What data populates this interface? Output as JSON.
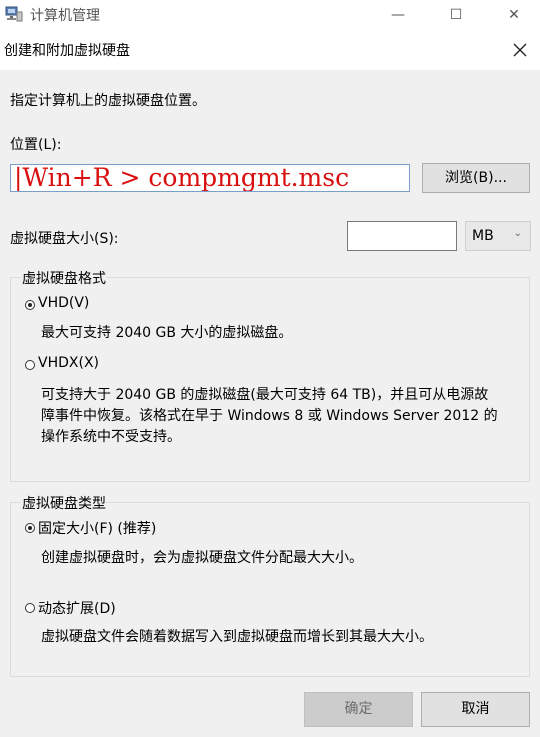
{
  "background_window": {
    "title": "计算机管理",
    "controls": {
      "minimize": "—",
      "maximize": "☐",
      "close": "✕"
    }
  },
  "dialog": {
    "title": "创建和附加虚拟硬盘",
    "instruction": "指定计算机上的虚拟硬盘位置。",
    "location": {
      "label": "位置(L):",
      "value": "|Win+R > compmgmt.msc",
      "browse_label": "浏览(B)..."
    },
    "size": {
      "label": "虚拟硬盘大小(S):",
      "value": "",
      "unit": "MB"
    },
    "format_group": {
      "legend": "虚拟硬盘格式",
      "options": [
        {
          "label": "VHD(V)",
          "checked": true,
          "description": "最大可支持 2040 GB 大小的虚拟磁盘。"
        },
        {
          "label": "VHDX(X)",
          "checked": false,
          "description_lines": [
            "可支持大于 2040 GB 的虚拟磁盘(最大可支持 64 TB)，并且可从电源故",
            "障事件中恢复。该格式在早于 Windows 8 或 Windows Server 2012 的",
            "操作系统中不受支持。"
          ]
        }
      ]
    },
    "type_group": {
      "legend": "虚拟硬盘类型",
      "options": [
        {
          "label": "固定大小(F) (推荐)",
          "checked": true,
          "description": "创建虚拟硬盘时，会为虚拟硬盘文件分配最大大小。"
        },
        {
          "label": "动态扩展(D)",
          "checked": false,
          "description": "虚拟硬盘文件会随着数据写入到虚拟硬盘而增长到其最大大小。"
        }
      ]
    },
    "buttons": {
      "ok": "确定",
      "cancel": "取消"
    }
  }
}
